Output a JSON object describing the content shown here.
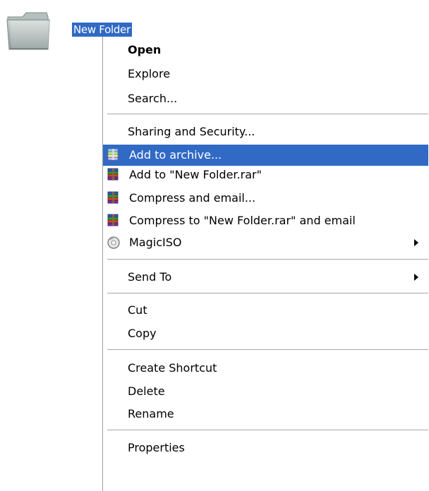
{
  "desktop": {
    "folder_label": "New Folder",
    "folder_icon": "folder-icon"
  },
  "context_menu": {
    "items": [
      {
        "label": "Open",
        "bold": true
      },
      {
        "label": "Explore"
      },
      {
        "label": "Search..."
      },
      {
        "label": "Sharing and Security..."
      },
      {
        "label": "Add to archive...",
        "icon": "winrar-icon",
        "highlighted": true
      },
      {
        "label": "Add to \"New Folder.rar\"",
        "icon": "winrar-icon"
      },
      {
        "label": "Compress and email...",
        "icon": "winrar-icon"
      },
      {
        "label": "Compress to \"New Folder.rar\" and email",
        "icon": "winrar-icon"
      },
      {
        "label": "MagicISO",
        "icon": "magiciso-icon",
        "submenu": true
      },
      {
        "label": "Send To",
        "submenu": true
      },
      {
        "label": "Cut"
      },
      {
        "label": "Copy"
      },
      {
        "label": "Create Shortcut"
      },
      {
        "label": "Delete"
      },
      {
        "label": "Rename"
      },
      {
        "label": "Properties"
      }
    ]
  },
  "colors": {
    "highlight": "#316ac5",
    "highlight_text": "#ffffff",
    "separator": "#a7a7a7",
    "menu_border": "#9d9d9d"
  }
}
